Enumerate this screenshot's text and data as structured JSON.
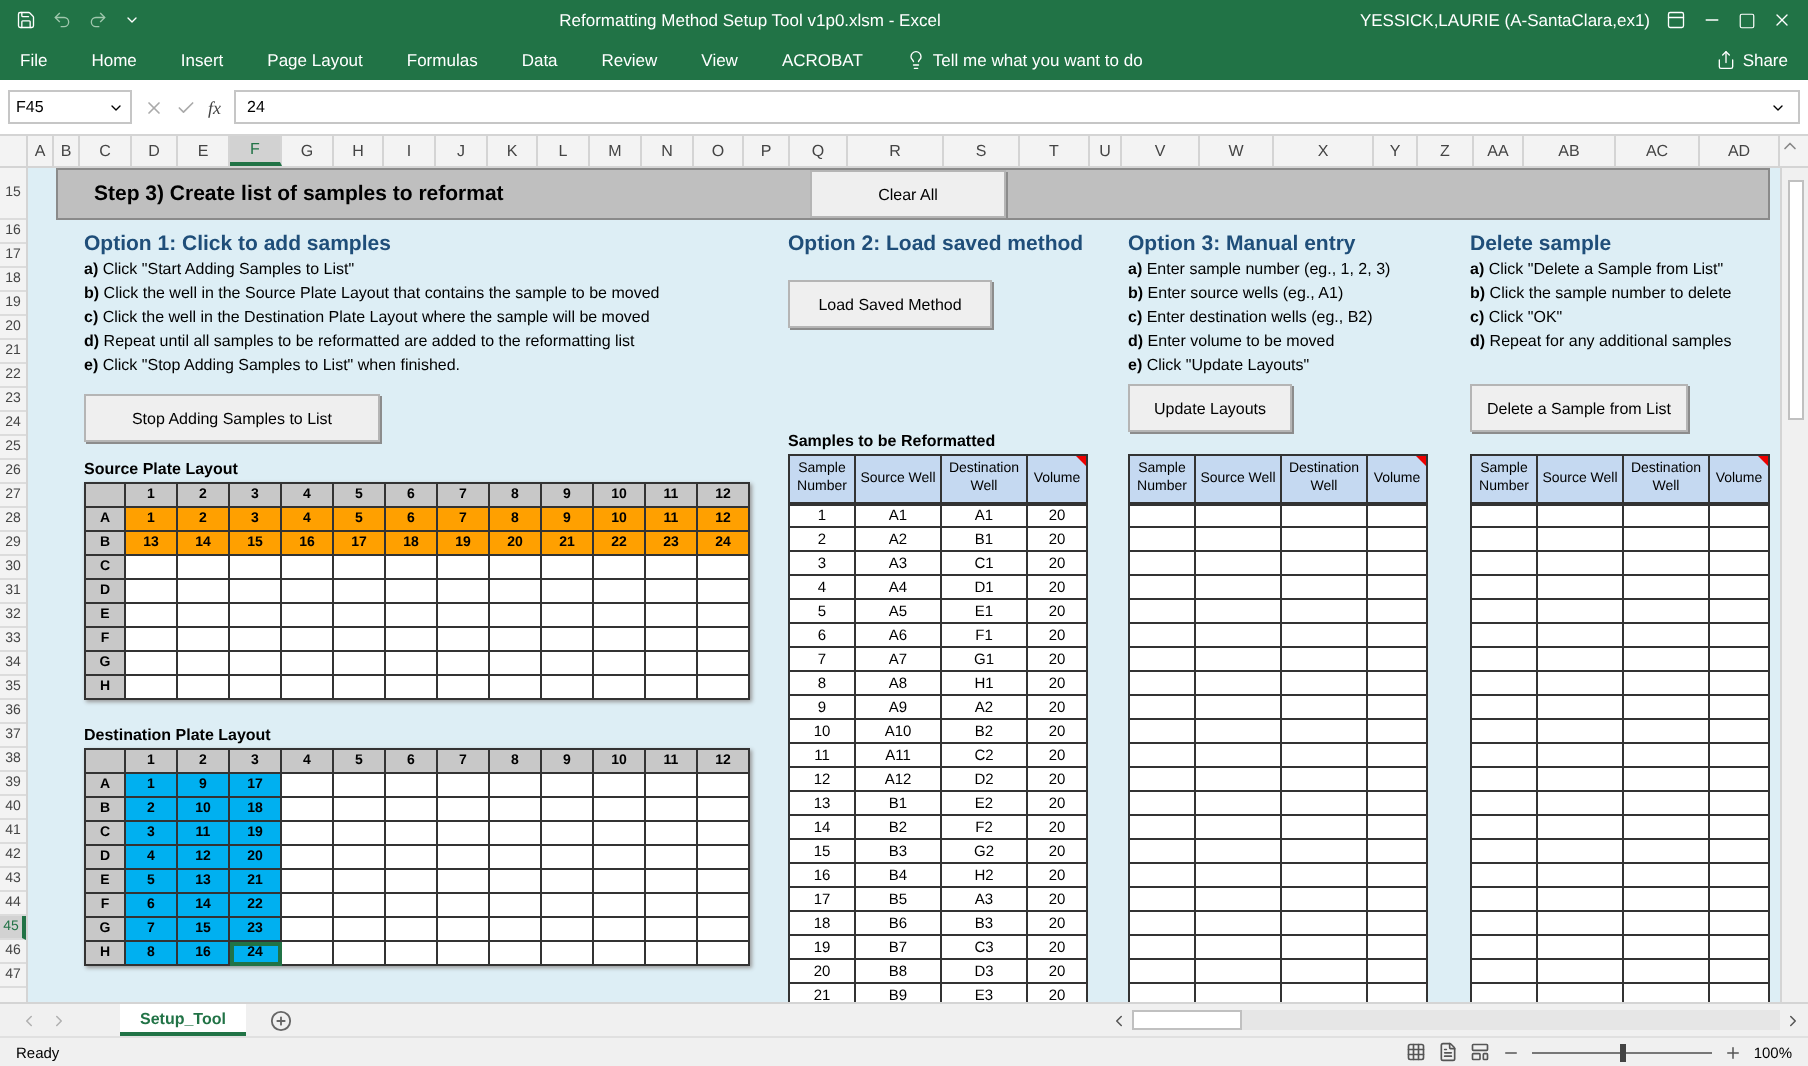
{
  "title_bar": {
    "title": "Reformatting Method Setup Tool v1p0.xlsm  -  Excel",
    "user": "YESSICK,LAURIE (A-SantaClara,ex1)"
  },
  "ribbon_tabs": [
    "File",
    "Home",
    "Insert",
    "Page Layout",
    "Formulas",
    "Data",
    "Review",
    "View",
    "ACROBAT"
  ],
  "tell_me": "Tell me what you want to do",
  "share": "Share",
  "formula_bar": {
    "name_box": "F45",
    "function_label": "fx",
    "value": "24"
  },
  "column_headers": [
    {
      "label": "A",
      "selected": false
    },
    {
      "label": "B",
      "selected": false
    },
    {
      "label": "C",
      "selected": false
    },
    {
      "label": "D",
      "selected": false
    },
    {
      "label": "E",
      "selected": false
    },
    {
      "label": "F",
      "selected": true
    },
    {
      "label": "G",
      "selected": false
    },
    {
      "label": "H",
      "selected": false
    },
    {
      "label": "I",
      "selected": false
    },
    {
      "label": "J",
      "selected": false
    },
    {
      "label": "K",
      "selected": false
    },
    {
      "label": "L",
      "selected": false
    },
    {
      "label": "M",
      "selected": false
    },
    {
      "label": "N",
      "selected": false
    },
    {
      "label": "O",
      "selected": false
    },
    {
      "label": "P",
      "selected": false
    },
    {
      "label": "Q",
      "selected": false
    },
    {
      "label": "R",
      "selected": false
    },
    {
      "label": "S",
      "selected": false
    },
    {
      "label": "T",
      "selected": false
    },
    {
      "label": "U",
      "selected": false
    },
    {
      "label": "V",
      "selected": false
    },
    {
      "label": "W",
      "selected": false
    },
    {
      "label": "X",
      "selected": false
    },
    {
      "label": "Y",
      "selected": false
    },
    {
      "label": "Z",
      "selected": false
    },
    {
      "label": "AA",
      "selected": false
    },
    {
      "label": "AB",
      "selected": false
    },
    {
      "label": "AC",
      "selected": false
    },
    {
      "label": "AD",
      "selected": false
    }
  ],
  "row_headers": [
    {
      "label": "15",
      "selected": false
    },
    {
      "label": "16",
      "selected": false
    },
    {
      "label": "17",
      "selected": false
    },
    {
      "label": "18",
      "selected": false
    },
    {
      "label": "19",
      "selected": false
    },
    {
      "label": "20",
      "selected": false
    },
    {
      "label": "21",
      "selected": false
    },
    {
      "label": "22",
      "selected": false
    },
    {
      "label": "23",
      "selected": false
    },
    {
      "label": "24",
      "selected": false
    },
    {
      "label": "25",
      "selected": false
    },
    {
      "label": "26",
      "selected": false
    },
    {
      "label": "27",
      "selected": false
    },
    {
      "label": "28",
      "selected": false
    },
    {
      "label": "29",
      "selected": false
    },
    {
      "label": "30",
      "selected": false
    },
    {
      "label": "31",
      "selected": false
    },
    {
      "label": "32",
      "selected": false
    },
    {
      "label": "33",
      "selected": false
    },
    {
      "label": "34",
      "selected": false
    },
    {
      "label": "35",
      "selected": false
    },
    {
      "label": "36",
      "selected": false
    },
    {
      "label": "37",
      "selected": false
    },
    {
      "label": "38",
      "selected": false
    },
    {
      "label": "39",
      "selected": false
    },
    {
      "label": "40",
      "selected": false
    },
    {
      "label": "41",
      "selected": false
    },
    {
      "label": "42",
      "selected": false
    },
    {
      "label": "43",
      "selected": false
    },
    {
      "label": "44",
      "selected": false
    },
    {
      "label": "45",
      "selected": true
    },
    {
      "label": "46",
      "selected": false
    },
    {
      "label": "47",
      "selected": false
    }
  ],
  "sheet": {
    "step_header": "Step 3) Create list of samples to reformat",
    "clear_button": "Clear All",
    "option1": {
      "heading": "Option 1: Click to add samples",
      "steps": [
        "**a)** Click \"Start Adding Samples to List\"",
        "**b)** Click the well in the Source Plate Layout that contains the sample to be moved",
        "**c)** Click the well in the Destination Plate Layout where the sample will be moved",
        "**d)** Repeat until all samples to be reformatted are added to the reformatting list",
        "**e)** Click \"Stop Adding Samples to List\" when finished."
      ],
      "button": "Stop Adding Samples to List"
    },
    "source_plate": {
      "title": "Source Plate Layout",
      "color": "#ffa000",
      "columns": [
        "1",
        "2",
        "3",
        "4",
        "5",
        "6",
        "7",
        "8",
        "9",
        "10",
        "11",
        "12"
      ],
      "rows": [
        {
          "label": "A",
          "cells": [
            {
              "value": "1",
              "selected": false
            },
            {
              "value": "2",
              "selected": false
            },
            {
              "value": "3",
              "selected": false
            },
            {
              "value": "4",
              "selected": false
            },
            {
              "value": "5",
              "selected": false
            },
            {
              "value": "6",
              "selected": false
            },
            {
              "value": "7",
              "selected": false
            },
            {
              "value": "8",
              "selected": false
            },
            {
              "value": "9",
              "selected": false
            },
            {
              "value": "10",
              "selected": false
            },
            {
              "value": "11",
              "selected": false
            },
            {
              "value": "12",
              "selected": false
            }
          ]
        },
        {
          "label": "B",
          "cells": [
            {
              "value": "13",
              "selected": false
            },
            {
              "value": "14",
              "selected": false
            },
            {
              "value": "15",
              "selected": false
            },
            {
              "value": "16",
              "selected": false
            },
            {
              "value": "17",
              "selected": false
            },
            {
              "value": "18",
              "selected": false
            },
            {
              "value": "19",
              "selected": false
            },
            {
              "value": "20",
              "selected": false
            },
            {
              "value": "21",
              "selected": false
            },
            {
              "value": "22",
              "selected": false
            },
            {
              "value": "23",
              "selected": false
            },
            {
              "value": "24",
              "selected": false
            }
          ]
        },
        {
          "label": "C"
        },
        {
          "label": "D"
        },
        {
          "label": "E"
        },
        {
          "label": "F"
        },
        {
          "label": "G"
        },
        {
          "label": "H"
        }
      ]
    },
    "destination_plate": {
      "title": "Destination Plate Layout",
      "color": "#00b0f0",
      "columns": [
        "1",
        "2",
        "3",
        "4",
        "5",
        "6",
        "7",
        "8",
        "9",
        "10",
        "11",
        "12"
      ],
      "rows": [
        {
          "label": "A",
          "cells": [
            {
              "value": "1",
              "selected": false
            },
            {
              "value": "9",
              "selected": false
            },
            {
              "value": "17",
              "selected": false
            }
          ]
        },
        {
          "label": "B",
          "cells": [
            {
              "value": "2",
              "selected": false
            },
            {
              "value": "10",
              "selected": false
            },
            {
              "value": "18",
              "selected": false
            }
          ]
        },
        {
          "label": "C",
          "cells": [
            {
              "value": "3",
              "selected": false
            },
            {
              "value": "11",
              "selected": false
            },
            {
              "value": "19",
              "selected": false
            }
          ]
        },
        {
          "label": "D",
          "cells": [
            {
              "value": "4",
              "selected": false
            },
            {
              "value": "12",
              "selected": false
            },
            {
              "value": "20",
              "selected": false
            }
          ]
        },
        {
          "label": "E",
          "cells": [
            {
              "value": "5",
              "selected": false
            },
            {
              "value": "13",
              "selected": false
            },
            {
              "value": "21",
              "selected": false
            }
          ]
        },
        {
          "label": "F",
          "cells": [
            {
              "value": "6",
              "selected": false
            },
            {
              "value": "14",
              "selected": false
            },
            {
              "value": "22",
              "selected": false
            }
          ]
        },
        {
          "label": "G",
          "cells": [
            {
              "value": "7",
              "selected": false
            },
            {
              "value": "15",
              "selected": false
            },
            {
              "value": "23",
              "selected": false
            }
          ]
        },
        {
          "label": "H",
          "cells": [
            {
              "value": "8",
              "selected": false
            },
            {
              "value": "16",
              "selected": false
            },
            {
              "value": "24",
              "selected": true
            }
          ]
        }
      ]
    },
    "option2": {
      "heading": "Option 2: Load saved method",
      "button": "Load Saved Method",
      "table_title": "Samples to be Reformatted",
      "table": {
        "comment_marker": true,
        "columns": [
          "Sample Number",
          "Source Well",
          "Destination Well",
          "Volume"
        ],
        "rows": [
          [
            "1",
            "A1",
            "A1",
            "20"
          ],
          [
            "2",
            "A2",
            "B1",
            "20"
          ],
          [
            "3",
            "A3",
            "C1",
            "20"
          ],
          [
            "4",
            "A4",
            "D1",
            "20"
          ],
          [
            "5",
            "A5",
            "E1",
            "20"
          ],
          [
            "6",
            "A6",
            "F1",
            "20"
          ],
          [
            "7",
            "A7",
            "G1",
            "20"
          ],
          [
            "8",
            "A8",
            "H1",
            "20"
          ],
          [
            "9",
            "A9",
            "A2",
            "20"
          ],
          [
            "10",
            "A10",
            "B2",
            "20"
          ],
          [
            "11",
            "A11",
            "C2",
            "20"
          ],
          [
            "12",
            "A12",
            "D2",
            "20"
          ],
          [
            "13",
            "B1",
            "E2",
            "20"
          ],
          [
            "14",
            "B2",
            "F2",
            "20"
          ],
          [
            "15",
            "B3",
            "G2",
            "20"
          ],
          [
            "16",
            "B4",
            "H2",
            "20"
          ],
          [
            "17",
            "B5",
            "A3",
            "20"
          ],
          [
            "18",
            "B6",
            "B3",
            "20"
          ],
          [
            "19",
            "B7",
            "C3",
            "20"
          ],
          [
            "20",
            "B8",
            "D3",
            "20"
          ],
          [
            "21",
            "B9",
            "E3",
            "20"
          ]
        ]
      }
    },
    "option3": {
      "heading": "Option 3: Manual entry",
      "steps": [
        "**a)** Enter sample number (eg., 1, 2, 3)",
        "**b)** Enter source wells (eg., A1)",
        "**c)** Enter destination wells (eg., B2)",
        "**d)** Enter volume to be moved",
        "**e)** Click \"Update Layouts\""
      ],
      "button": "Update Layouts",
      "table": {
        "comment_marker": true,
        "columns": [
          "Sample Number",
          "Source Well",
          "Destination Well",
          "Volume"
        ]
      }
    },
    "delete": {
      "heading": "Delete sample",
      "steps": [
        "**a)** Click \"Delete a Sample from List\"",
        "**b)** Click the sample number to delete",
        "**c)** Click \"OK\"",
        "**d)** Repeat for any additional samples"
      ],
      "button": "Delete a Sample from List",
      "table": {
        "comment_marker": true,
        "columns": [
          "Sample Number",
          "Source Well",
          "Destination Well",
          "Volume"
        ]
      }
    }
  },
  "sheet_tabs": [
    {
      "label": "Setup_Tool",
      "selected": true
    }
  ],
  "status_bar": {
    "status": "Ready",
    "zoom_label": "100%",
    "zoom_slider": {
      "level": 0.5
    }
  }
}
